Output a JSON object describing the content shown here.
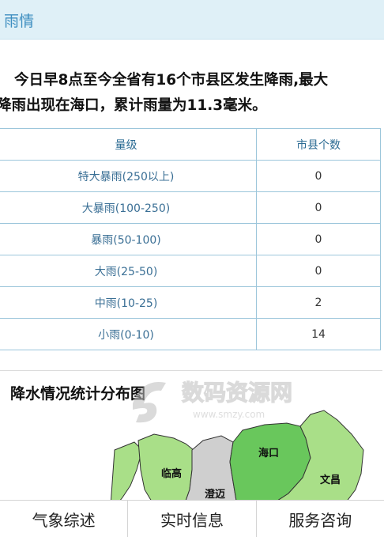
{
  "header": {
    "title": "雨情"
  },
  "summary": {
    "line1": "今日早8点至今全省有16个市县区发生降雨,最大",
    "line2": "降雨出现在海口，累计雨量为11.3毫米。"
  },
  "rain_table": {
    "headers": [
      "量级",
      "市县个数"
    ],
    "rows": [
      {
        "level": "特大暴雨(250以上)",
        "count": "0"
      },
      {
        "level": "大暴雨(100-250)",
        "count": "0"
      },
      {
        "level": "暴雨(50-100)",
        "count": "0"
      },
      {
        "level": "大雨(25-50)",
        "count": "0"
      },
      {
        "level": "中雨(10-25)",
        "count": "2"
      },
      {
        "level": "小雨(0-10)",
        "count": "14"
      }
    ]
  },
  "map": {
    "title": "降水情况统计分布图",
    "labels": {
      "linggao": "临高",
      "chengmai": "澄迈",
      "haikou": "海口",
      "wenchang": "文昌"
    },
    "colors": {
      "light_green": "#a9df88",
      "mid_green": "#69c75c",
      "gray": "#cfcfcf",
      "border": "#333333"
    }
  },
  "watermark": {
    "text": "数码资源网",
    "url": "www.smzy.com"
  },
  "tabbar": {
    "tabs": [
      "气象综述",
      "实时信息",
      "服务咨询"
    ]
  }
}
